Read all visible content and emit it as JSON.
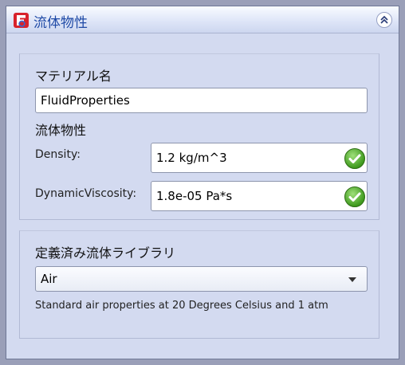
{
  "panel": {
    "title": "流体物性",
    "logo_letter": "F"
  },
  "material": {
    "heading": "マテリアル名",
    "name_value": "FluidProperties"
  },
  "properties": {
    "heading": "流体物性",
    "density_label": "Density:",
    "density_value": "1.2 kg/m^3",
    "viscosity_label": "DynamicViscosity:",
    "viscosity_value": "1.8e-05 Pa*s"
  },
  "library": {
    "heading": "定義済み流体ライブラリ",
    "selected": "Air",
    "description": "Standard air properties at 20 Degrees Celsius and 1 atm"
  },
  "colors": {
    "panel_bg": "#d3daf0",
    "title_text": "#1f4aa6",
    "logo_red": "#d8222b",
    "valid_green": "#3f9a1e"
  }
}
